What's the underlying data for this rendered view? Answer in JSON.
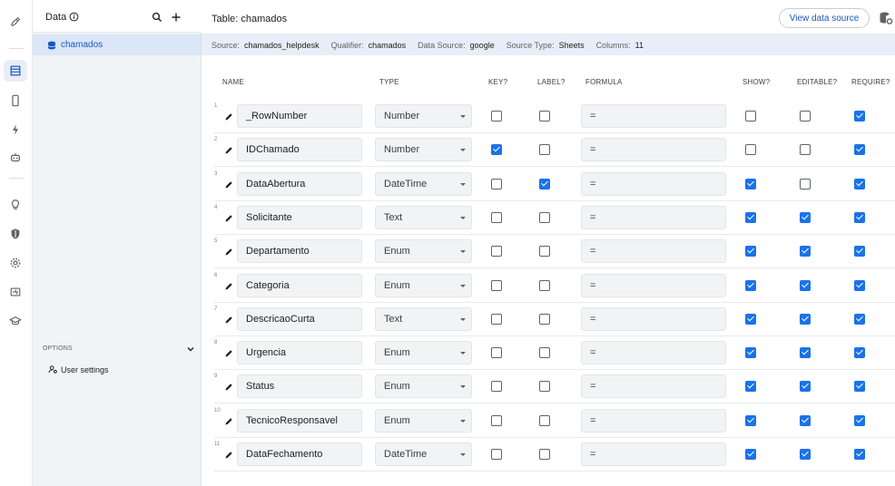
{
  "rail": {
    "icons": [
      "ui-design-icon",
      "data-icon",
      "mobile-icon",
      "automation-icon",
      "behavior-icon",
      "intelligence-icon",
      "security-icon",
      "settings-icon",
      "manage-icon",
      "learn-icon"
    ]
  },
  "panel": {
    "title": "Data",
    "table_item": "chamados",
    "options_label": "OPTIONS",
    "user_settings": "User settings"
  },
  "main": {
    "title": "Table: chamados",
    "view_data_source": "View data source",
    "info": {
      "source_label": "Source:",
      "source": "chamados_helpdesk",
      "qualifier_label": "Qualifier:",
      "qualifier": "chamados",
      "data_source_label": "Data Source:",
      "data_source": "google",
      "source_type_label": "Source Type:",
      "source_type": "Sheets",
      "columns_label": "Columns:",
      "columns": "11"
    },
    "headers": {
      "name": "NAME",
      "type": "TYPE",
      "key": "KEY?",
      "label": "LABEL?",
      "formula": "FORMULA",
      "show": "SHOW?",
      "editable": "EDITABLE?",
      "require": "REQUIRE?"
    },
    "rows": [
      {
        "num": "1",
        "name": "_RowNumber",
        "type": "Number",
        "formula": "=",
        "key": false,
        "label": false,
        "show": false,
        "editable": false,
        "require": true
      },
      {
        "num": "2",
        "name": "IDChamado",
        "type": "Number",
        "formula": "=",
        "key": true,
        "label": false,
        "show": false,
        "editable": false,
        "require": true
      },
      {
        "num": "3",
        "name": "DataAbertura",
        "type": "DateTime",
        "formula": "=",
        "key": false,
        "label": true,
        "show": true,
        "editable": false,
        "require": true
      },
      {
        "num": "4",
        "name": "Solicitante",
        "type": "Text",
        "formula": "=",
        "key": false,
        "label": false,
        "show": true,
        "editable": true,
        "require": true
      },
      {
        "num": "5",
        "name": "Departamento",
        "type": "Enum",
        "formula": "=",
        "key": false,
        "label": false,
        "show": true,
        "editable": true,
        "require": true
      },
      {
        "num": "6",
        "name": "Categoria",
        "type": "Enum",
        "formula": "=",
        "key": false,
        "label": false,
        "show": true,
        "editable": true,
        "require": true
      },
      {
        "num": "7",
        "name": "DescricaoCurta",
        "type": "Text",
        "formula": "=",
        "key": false,
        "label": false,
        "show": true,
        "editable": true,
        "require": true
      },
      {
        "num": "8",
        "name": "Urgencia",
        "type": "Enum",
        "formula": "=",
        "key": false,
        "label": false,
        "show": true,
        "editable": true,
        "require": true
      },
      {
        "num": "9",
        "name": "Status",
        "type": "Enum",
        "formula": "=",
        "key": false,
        "label": false,
        "show": true,
        "editable": true,
        "require": true
      },
      {
        "num": "10",
        "name": "TecnicoResponsavel",
        "type": "Enum",
        "formula": "=",
        "key": false,
        "label": false,
        "show": true,
        "editable": true,
        "require": true
      },
      {
        "num": "11",
        "name": "DataFechamento",
        "type": "DateTime",
        "formula": "=",
        "key": false,
        "label": false,
        "show": true,
        "editable": true,
        "require": true
      }
    ]
  }
}
